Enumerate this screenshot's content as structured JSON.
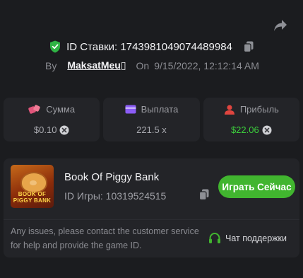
{
  "bet": {
    "id_label": "ID Ставки: 1743981049074489984",
    "by_label": "By",
    "user": "MaksatMeu▯",
    "on_label": "On",
    "date": "9/15/2022, 12:12:14 AM"
  },
  "stats": [
    {
      "label": "Сумма",
      "value": "$0.10"
    },
    {
      "label": "Выплата",
      "value": "221.5 x"
    },
    {
      "label": "Прибыль",
      "value": "$22.06"
    }
  ],
  "game": {
    "name": "Book Of Piggy Bank",
    "id_label": "ID Игры: 10319524515",
    "cover_title_line1": "BOOK OF",
    "cover_title_line2": "PIGGY BANK",
    "play_label": "Играть Сейчас"
  },
  "support": {
    "text": "Any issues, please contact the customer service for help and provide the game ID.",
    "button_label": "Чат поддержки"
  },
  "colors": {
    "background": "#1b1c1f",
    "card": "#232428",
    "accent_green": "#41b52f",
    "profit_green": "#3ccf3c",
    "amount_icon": "#e0557a",
    "payout_icon": "#8b5cf6",
    "profit_icon": "#e0453f"
  },
  "icons": {
    "share": "share-arrow-icon",
    "verified": "verified-shield-icon",
    "copy": "copy-icon",
    "amount": "dice-icon",
    "payout": "wallet-icon",
    "profit": "user-profit-icon",
    "currency": "currency-coin-icon",
    "support": "headset-icon"
  }
}
